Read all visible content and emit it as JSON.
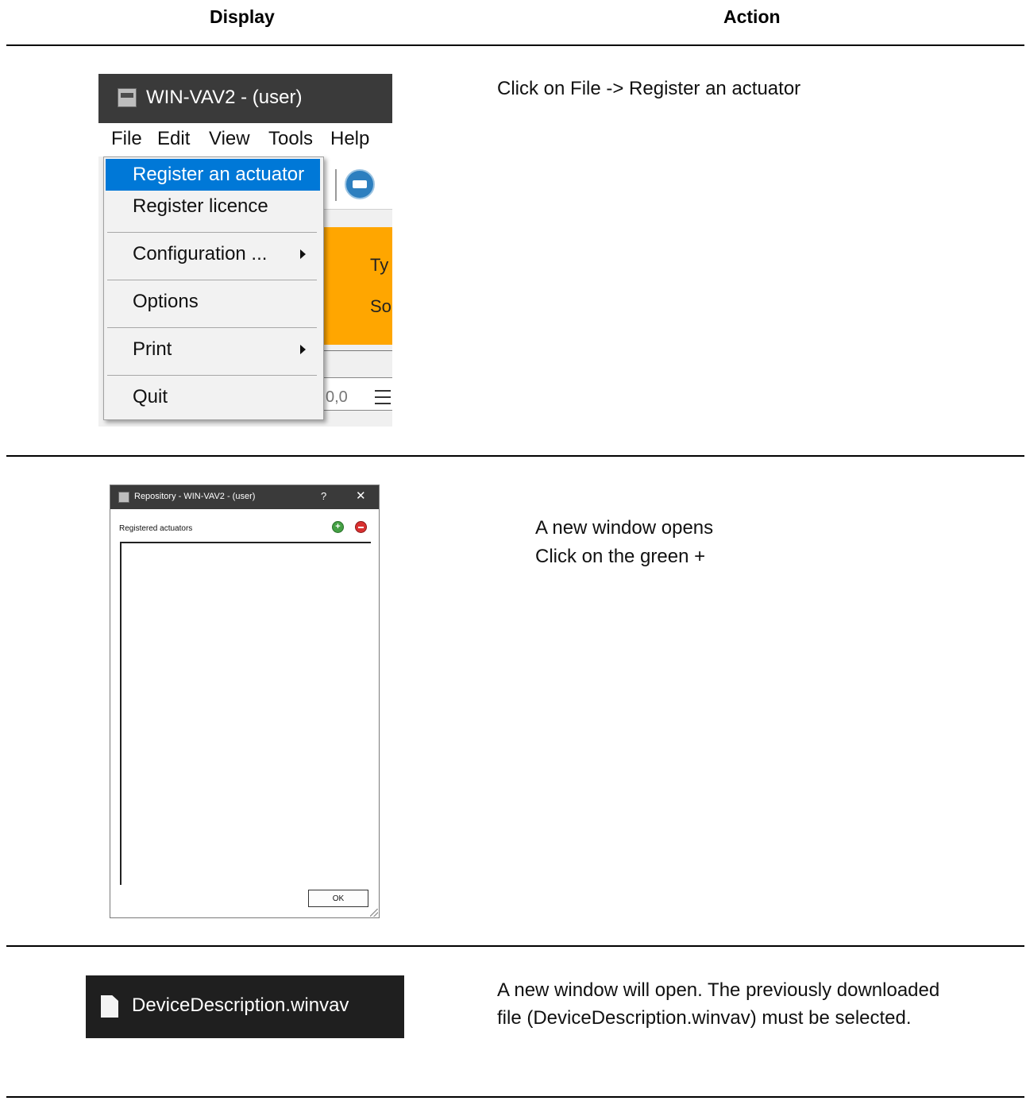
{
  "table": {
    "header_display": "Display",
    "header_action": "Action"
  },
  "rows": [
    {
      "action_lines": [
        "Click on File -> Register an actuator"
      ],
      "screenshot": {
        "window_title": "WIN-VAV2 - (user)",
        "menubar": [
          "File",
          "Edit",
          "View",
          "Tools",
          "Help"
        ],
        "file_menu": {
          "items": [
            "Register an actuator",
            "Register licence",
            "Configuration ...",
            "Options",
            "Print",
            "Quit"
          ],
          "selected": "Register an actuator"
        },
        "background_fragments": [
          "Ty",
          "So",
          "0,0"
        ],
        "highlight_color": "#0078d7",
        "panel_color": "#ffa600"
      }
    },
    {
      "action_lines": [
        "A new window opens",
        "Click on the green +"
      ],
      "dialog": {
        "title": "Repository - WIN-VAV2 - (user)",
        "help_glyph": "?",
        "close_glyph": "✕",
        "list_label": "Registered actuators",
        "add_glyph": "+",
        "ok_label": "OK"
      }
    },
    {
      "action_lines": [
        "A new window will open. The previously downloaded",
        "file (DeviceDescription.winvav) must be selected."
      ],
      "file": {
        "name": "DeviceDescription.winvav",
        "icon": "file-icon"
      }
    }
  ]
}
